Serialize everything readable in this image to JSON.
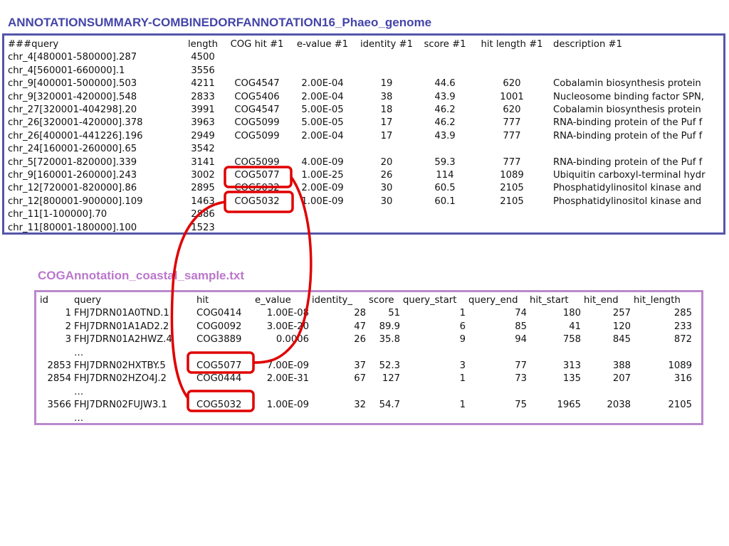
{
  "titles": {
    "top": "ANNOTATIONSUMMARY-COMBINEDORFANNOTATION16_Phaeo_genome",
    "bottom": "COGAnnotation_coastal_sample.txt"
  },
  "colors": {
    "top_title": "#4444aa",
    "top_border": "#5555aa",
    "bottom_title": "#bb77cc",
    "bottom_border": "#bb88cc",
    "highlight": "#e00000"
  },
  "summary": {
    "headers": [
      "###query",
      "length",
      "COG hit #1",
      "e-value #1",
      "identity #1",
      "score #1",
      "hit length #1",
      "description #1"
    ],
    "rows": [
      [
        "chr_4[480001-580000].287",
        "4500",
        "",
        "",
        "",
        "",
        "",
        ""
      ],
      [
        "chr_4[560001-660000].1",
        "3556",
        "",
        "",
        "",
        "",
        "",
        ""
      ],
      [
        "chr_9[400001-500000].503",
        "4211",
        "COG4547",
        "2.00E-04",
        "19",
        "44.6",
        "620",
        "Cobalamin biosynthesis protein"
      ],
      [
        "chr_9[320001-420000].548",
        "2833",
        "COG5406",
        "2.00E-04",
        "38",
        "43.9",
        "1001",
        "Nucleosome binding factor SPN,"
      ],
      [
        "chr_27[320001-404298].20",
        "3991",
        "COG4547",
        "5.00E-05",
        "18",
        "46.2",
        "620",
        "Cobalamin biosynthesis protein"
      ],
      [
        "chr_26[320001-420000].378",
        "3963",
        "COG5099",
        "5.00E-05",
        "17",
        "46.2",
        "777",
        "RNA-binding protein of the Puf f"
      ],
      [
        "chr_26[400001-441226].196",
        "2949",
        "COG5099",
        "2.00E-04",
        "17",
        "43.9",
        "777",
        "RNA-binding protein of the Puf f"
      ],
      [
        "chr_24[160001-260000].65",
        "3542",
        "",
        "",
        "",
        "",
        "",
        ""
      ],
      [
        "chr_5[720001-820000].339",
        "3141",
        "COG5099",
        "4.00E-09",
        "20",
        "59.3",
        "777",
        "RNA-binding protein of the Puf f"
      ],
      [
        "chr_9[160001-260000].243",
        "3002",
        "COG5077",
        "1.00E-25",
        "26",
        "114",
        "1089",
        "Ubiquitin carboxyl-terminal hydr"
      ],
      [
        "chr_12[720001-820000].86",
        "2895",
        "COG5032",
        "2.00E-09",
        "30",
        "60.5",
        "2105",
        "Phosphatidylinositol kinase and"
      ],
      [
        "chr_12[800001-900000].109",
        "1463",
        "COG5032",
        "1.00E-09",
        "30",
        "60.1",
        "2105",
        "Phosphatidylinositol kinase and"
      ],
      [
        "chr_11[1-100000].70",
        "2886",
        "",
        "",
        "",
        "",
        "",
        ""
      ],
      [
        "chr_11[80001-180000].100",
        "1523",
        "",
        "",
        "",
        "",
        "",
        ""
      ]
    ]
  },
  "coastal": {
    "headers": [
      "id",
      "query",
      "hit",
      "e_value",
      "identity_",
      "score",
      "query_start",
      "query_end",
      "hit_start",
      "hit_end",
      "hit_length"
    ],
    "rows": [
      [
        "1",
        "FHJ7DRN01A0TND.1",
        "COG0414",
        "1.00E-08",
        "28",
        "51",
        "1",
        "74",
        "180",
        "257",
        "285"
      ],
      [
        "2",
        "FHJ7DRN01A1AD2.2",
        "COG0092",
        "3.00E-20",
        "47",
        "89.9",
        "6",
        "85",
        "41",
        "120",
        "233"
      ],
      [
        "3",
        "FHJ7DRN01A2HWZ.4",
        "COG3889",
        "0.0006",
        "26",
        "35.8",
        "9",
        "94",
        "758",
        "845",
        "872"
      ],
      [
        "",
        "…",
        "",
        "",
        "",
        "",
        "",
        "",
        "",
        "",
        ""
      ],
      [
        "2853",
        "FHJ7DRN02HXTBY.5",
        "COG5077",
        "7.00E-09",
        "37",
        "52.3",
        "3",
        "77",
        "313",
        "388",
        "1089"
      ],
      [
        "2854",
        "FHJ7DRN02HZO4J.2",
        "COG0444",
        "2.00E-31",
        "67",
        "127",
        "1",
        "73",
        "135",
        "207",
        "316"
      ],
      [
        "",
        "…",
        "",
        "",
        "",
        "",
        "",
        "",
        "",
        "",
        ""
      ],
      [
        "3566",
        "FHJ7DRN02FUJW3.1",
        "COG5032",
        "1.00E-09",
        "32",
        "54.7",
        "1",
        "75",
        "1965",
        "2038",
        "2105"
      ],
      [
        "",
        "…",
        "",
        "",
        "",
        "",
        "",
        "",
        "",
        "",
        ""
      ]
    ]
  }
}
